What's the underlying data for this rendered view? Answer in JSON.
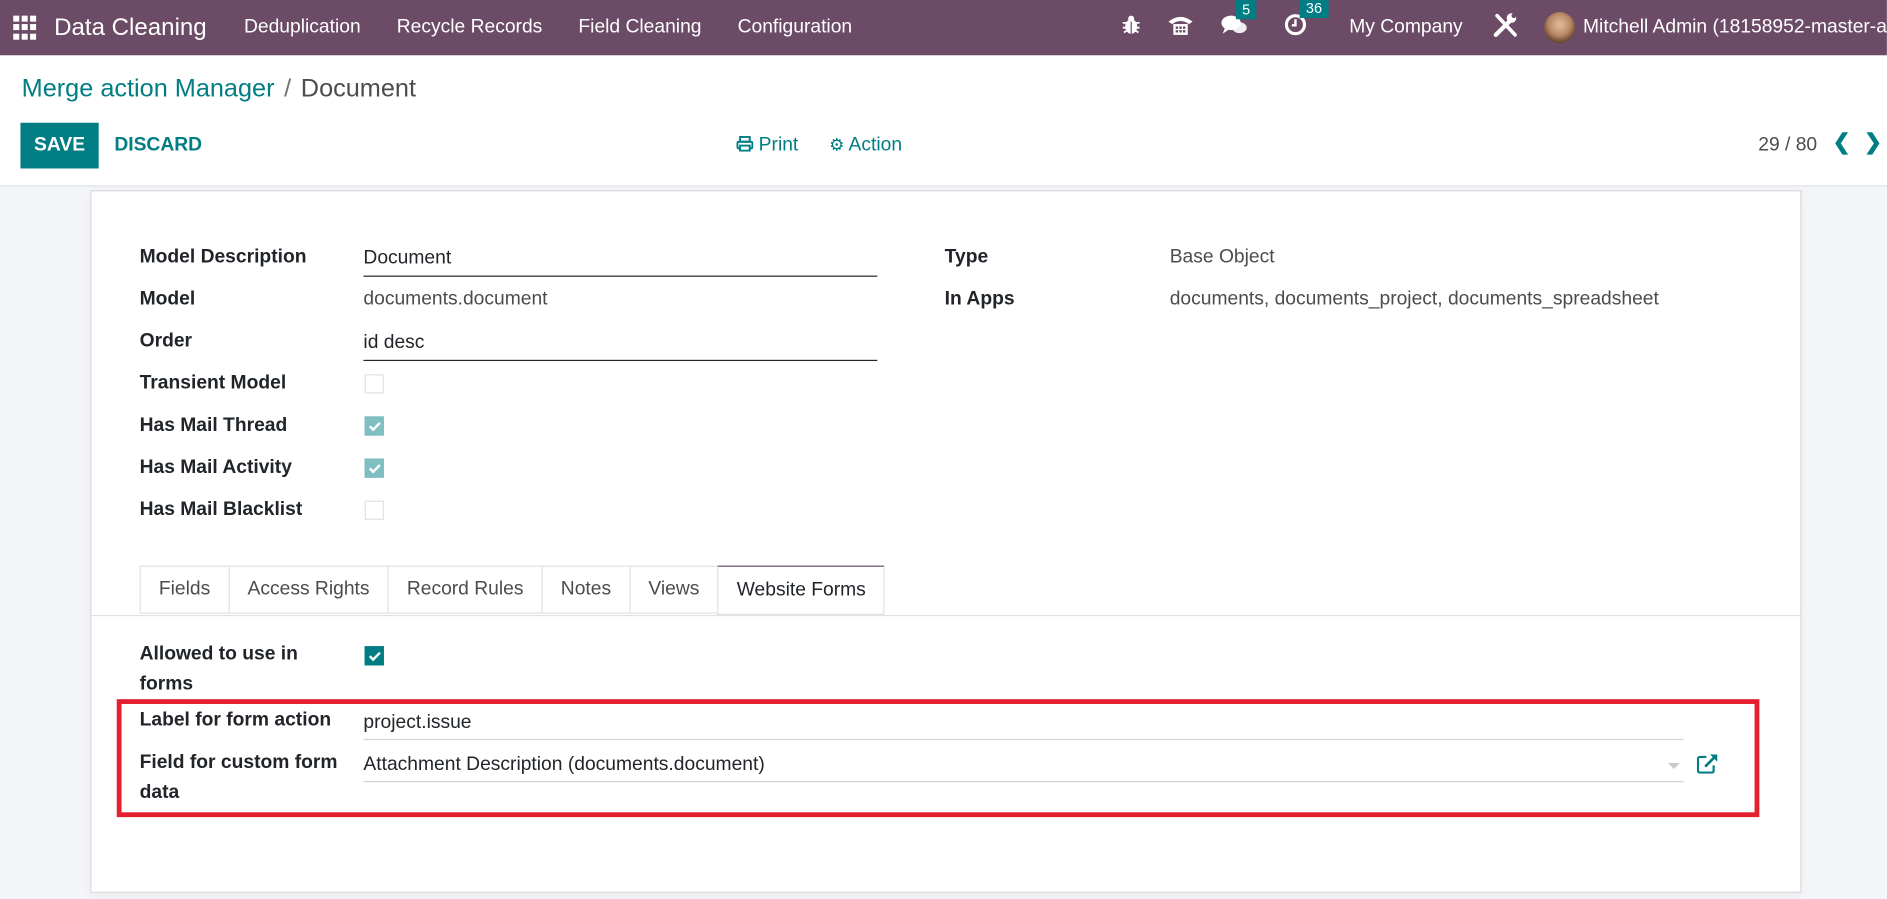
{
  "navbar": {
    "app_name": "Data Cleaning",
    "menus": [
      "Deduplication",
      "Recycle Records",
      "Field Cleaning",
      "Configuration"
    ],
    "messages_count": "5",
    "activities_count": "36",
    "company": "My Company",
    "user": "Mitchell Admin (18158952-master-a",
    "icons": [
      "apps-grid-icon",
      "bug-icon",
      "phone-icon",
      "chat-icon",
      "clock-icon",
      "tools-icon"
    ]
  },
  "breadcrumb": {
    "parent": "Merge action Manager",
    "separator": "/",
    "current": "Document"
  },
  "toolbar": {
    "save": "SAVE",
    "discard": "DISCARD",
    "print": "Print",
    "action": "Action",
    "pager": "29 / 80"
  },
  "form": {
    "left": [
      {
        "label": "Model Description",
        "value": "Document"
      },
      {
        "label": "Model",
        "value": "documents.document"
      },
      {
        "label": "Order",
        "value": "id desc"
      },
      {
        "label": "Transient Model",
        "checked": false
      },
      {
        "label": "Has Mail Thread",
        "checked": true
      },
      {
        "label": "Has Mail Activity",
        "checked": true
      },
      {
        "label": "Has Mail Blacklist",
        "checked": false
      }
    ],
    "right": [
      {
        "label": "Type",
        "value": "Base Object"
      },
      {
        "label": "In Apps",
        "value": "documents, documents_project, documents_spreadsheet"
      }
    ]
  },
  "tabs": [
    {
      "label": "Fields",
      "active": false
    },
    {
      "label": "Access Rights",
      "active": false
    },
    {
      "label": "Record Rules",
      "active": false
    },
    {
      "label": "Notes",
      "active": false
    },
    {
      "label": "Views",
      "active": false
    },
    {
      "label": "Website Forms",
      "active": true
    }
  ],
  "website_forms": {
    "allowed_label_1": "Allowed to use in",
    "allowed_label_2": "forms",
    "allowed_checked": true,
    "form_action_label": "Label for form action",
    "form_action_value": "project.issue",
    "custom_field_label_1": "Field for custom form",
    "custom_field_label_2": "data",
    "custom_field_value": "Attachment Description (documents.document)"
  },
  "colors": {
    "brand": "#6b4b66",
    "accent": "#017e84",
    "highlight": "#e4202e"
  }
}
